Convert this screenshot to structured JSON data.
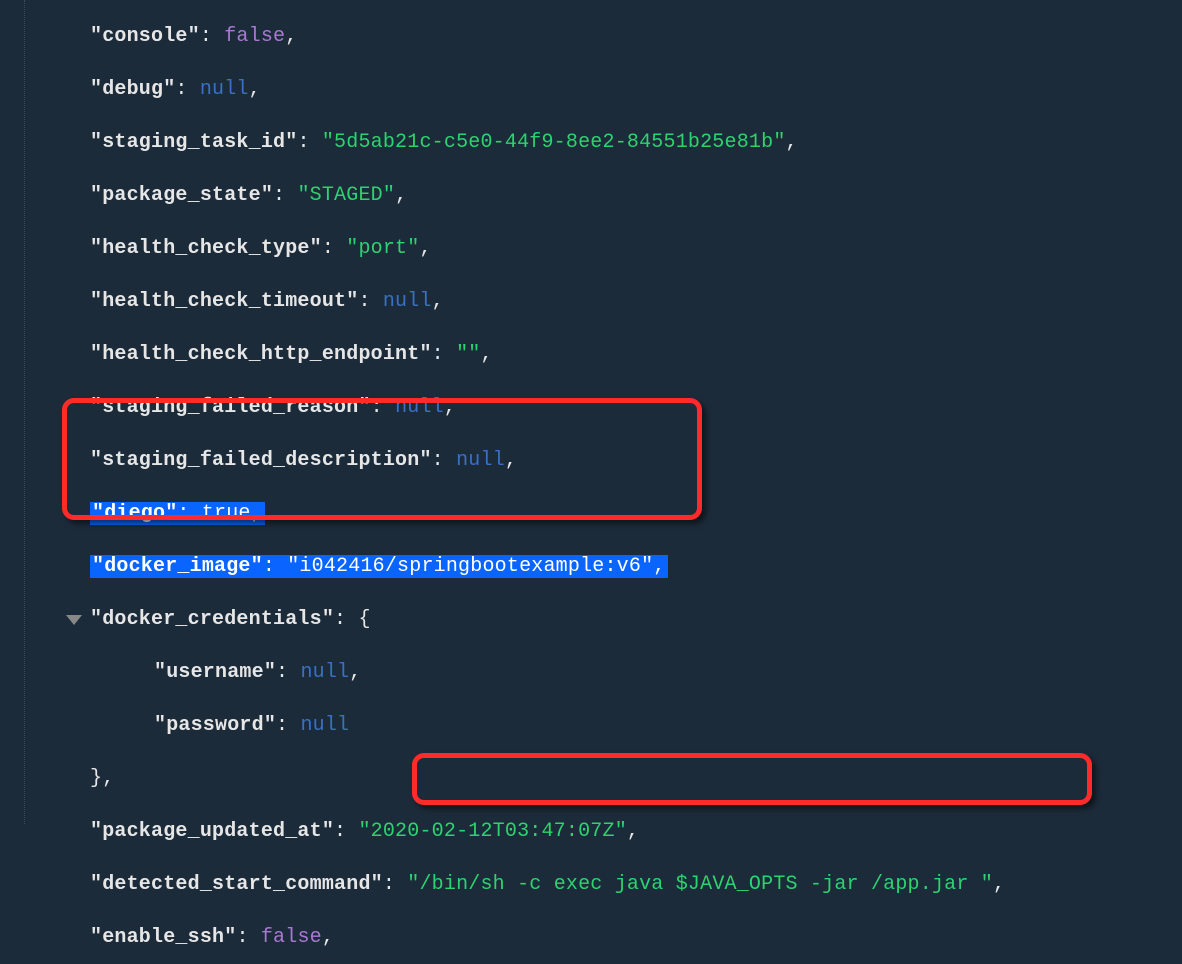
{
  "json": {
    "console": {
      "key": "\"console\"",
      "value": "false",
      "type": "bool"
    },
    "debug": {
      "key": "\"debug\"",
      "value": "null",
      "type": "null"
    },
    "staging_task_id": {
      "key": "\"staging_task_id\"",
      "value": "\"5d5ab21c-c5e0-44f9-8ee2-84551b25e81b\"",
      "type": "str"
    },
    "package_state": {
      "key": "\"package_state\"",
      "value": "\"STAGED\"",
      "type": "str"
    },
    "health_check_type": {
      "key": "\"health_check_type\"",
      "value": "\"port\"",
      "type": "str"
    },
    "health_check_timeout": {
      "key": "\"health_check_timeout\"",
      "value": "null",
      "type": "null"
    },
    "health_check_http_endpoint": {
      "key": "\"health_check_http_endpoint\"",
      "value": "\"\"",
      "type": "str"
    },
    "staging_failed_reason": {
      "key": "\"staging_failed_reason\"",
      "value": "null",
      "type": "null"
    },
    "staging_failed_description": {
      "key": "\"staging_failed_description\"",
      "value": "null",
      "type": "null"
    },
    "diego": {
      "key": "\"diego\"",
      "value": "true",
      "type": "truebool"
    },
    "docker_image": {
      "key": "\"docker_image\"",
      "value": "\"i042416/springbootexample:v6\"",
      "type": "str"
    },
    "docker_credentials": {
      "key": "\"docker_credentials\"",
      "value": "{",
      "type": "brace"
    },
    "username": {
      "key": "\"username\"",
      "value": "null",
      "type": "null"
    },
    "password": {
      "key": "\"password\"",
      "value": "null",
      "type": "null"
    },
    "close_cred": {
      "value": "},"
    },
    "package_updated_at": {
      "key": "\"package_updated_at\"",
      "value": "\"2020-02-12T03:47:07Z\"",
      "type": "str"
    },
    "detected_start_command": {
      "key": "\"detected_start_command\"",
      "value": "\"/bin/sh -c exec java $JAVA_OPTS -jar /app.jar \"",
      "type": "str"
    },
    "enable_ssh": {
      "key": "\"enable_ssh\"",
      "value": "false",
      "type": "bool"
    }
  }
}
